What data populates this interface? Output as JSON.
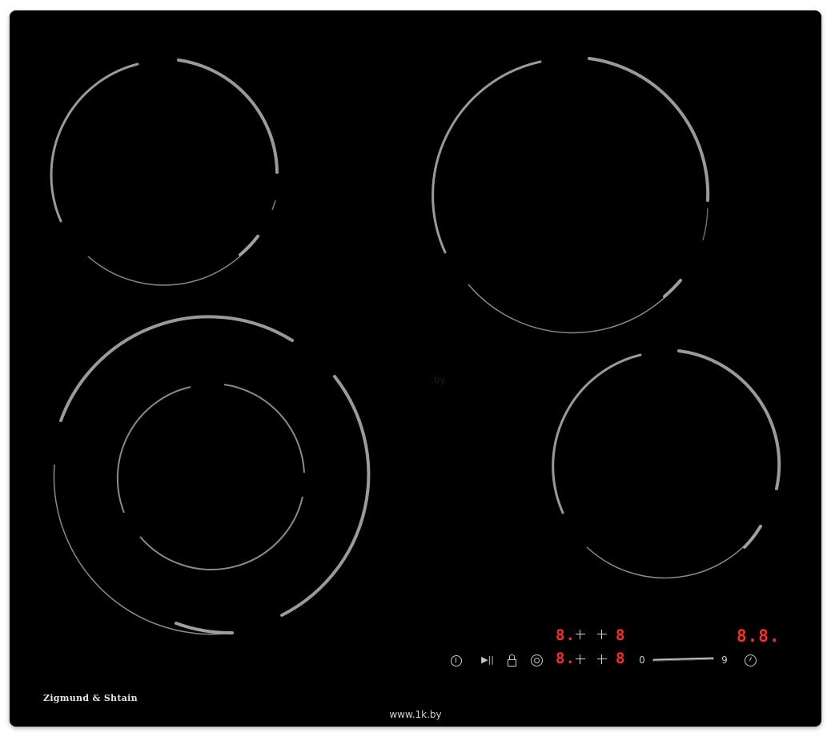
{
  "brand": {
    "name": "Zigmund & Shtain"
  },
  "watermark": {
    "text": "www.1k.by",
    "center_mark": ".by"
  },
  "controls": {
    "timer_left_top": "8.",
    "timer_right_top": "8",
    "timer_left_bottom": "8.",
    "timer_right_bottom": "8",
    "main_display": "8.8.",
    "slider_min": "0",
    "slider_max": "9",
    "slider_level_percent": 100
  },
  "icons": {
    "power": "power-icon",
    "play_pause": "play-pause-icon",
    "lock": "lock-icon",
    "zone_select": "zone-select-icon",
    "timer": "timer-icon"
  },
  "colors": {
    "glass": "#000000",
    "zone_marking": "#8a8a8a",
    "display_red": "#ff2a2a"
  }
}
